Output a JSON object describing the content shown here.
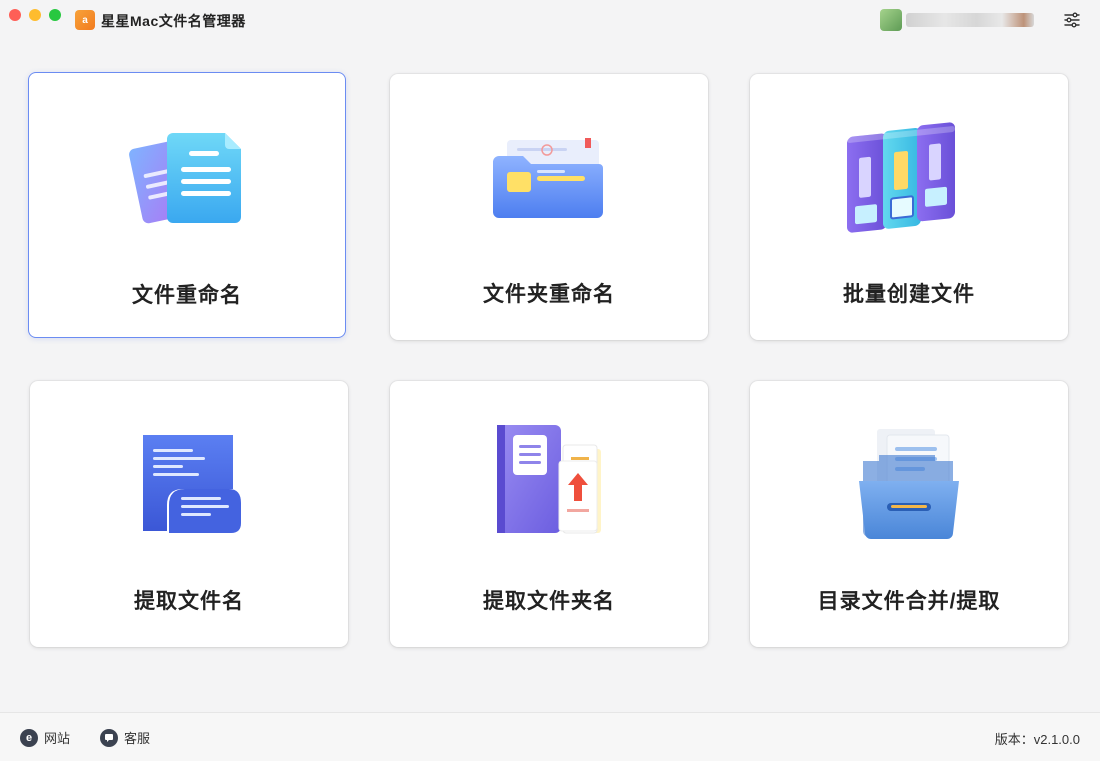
{
  "window": {
    "title": "星星Mac文件名管理器",
    "logo_text": "a"
  },
  "cards": [
    {
      "label": "文件重命名",
      "icon": "file-rename-icon",
      "selected": true
    },
    {
      "label": "文件夹重命名",
      "icon": "folder-rename-icon",
      "selected": false
    },
    {
      "label": "批量创建文件",
      "icon": "batch-create-icon",
      "selected": false
    },
    {
      "label": "提取文件名",
      "icon": "extract-filename-icon",
      "selected": false
    },
    {
      "label": "提取文件夹名",
      "icon": "extract-foldername-icon",
      "selected": false
    },
    {
      "label": "目录文件合并/提取",
      "icon": "directory-merge-icon",
      "selected": false
    }
  ],
  "footer": {
    "website_label": "网站",
    "website_icon_text": "e",
    "support_label": "客服",
    "version_text": "版本：v2.1.0.0"
  },
  "colors": {
    "accent": "#6b8cf2",
    "background": "#f4f4f5"
  }
}
